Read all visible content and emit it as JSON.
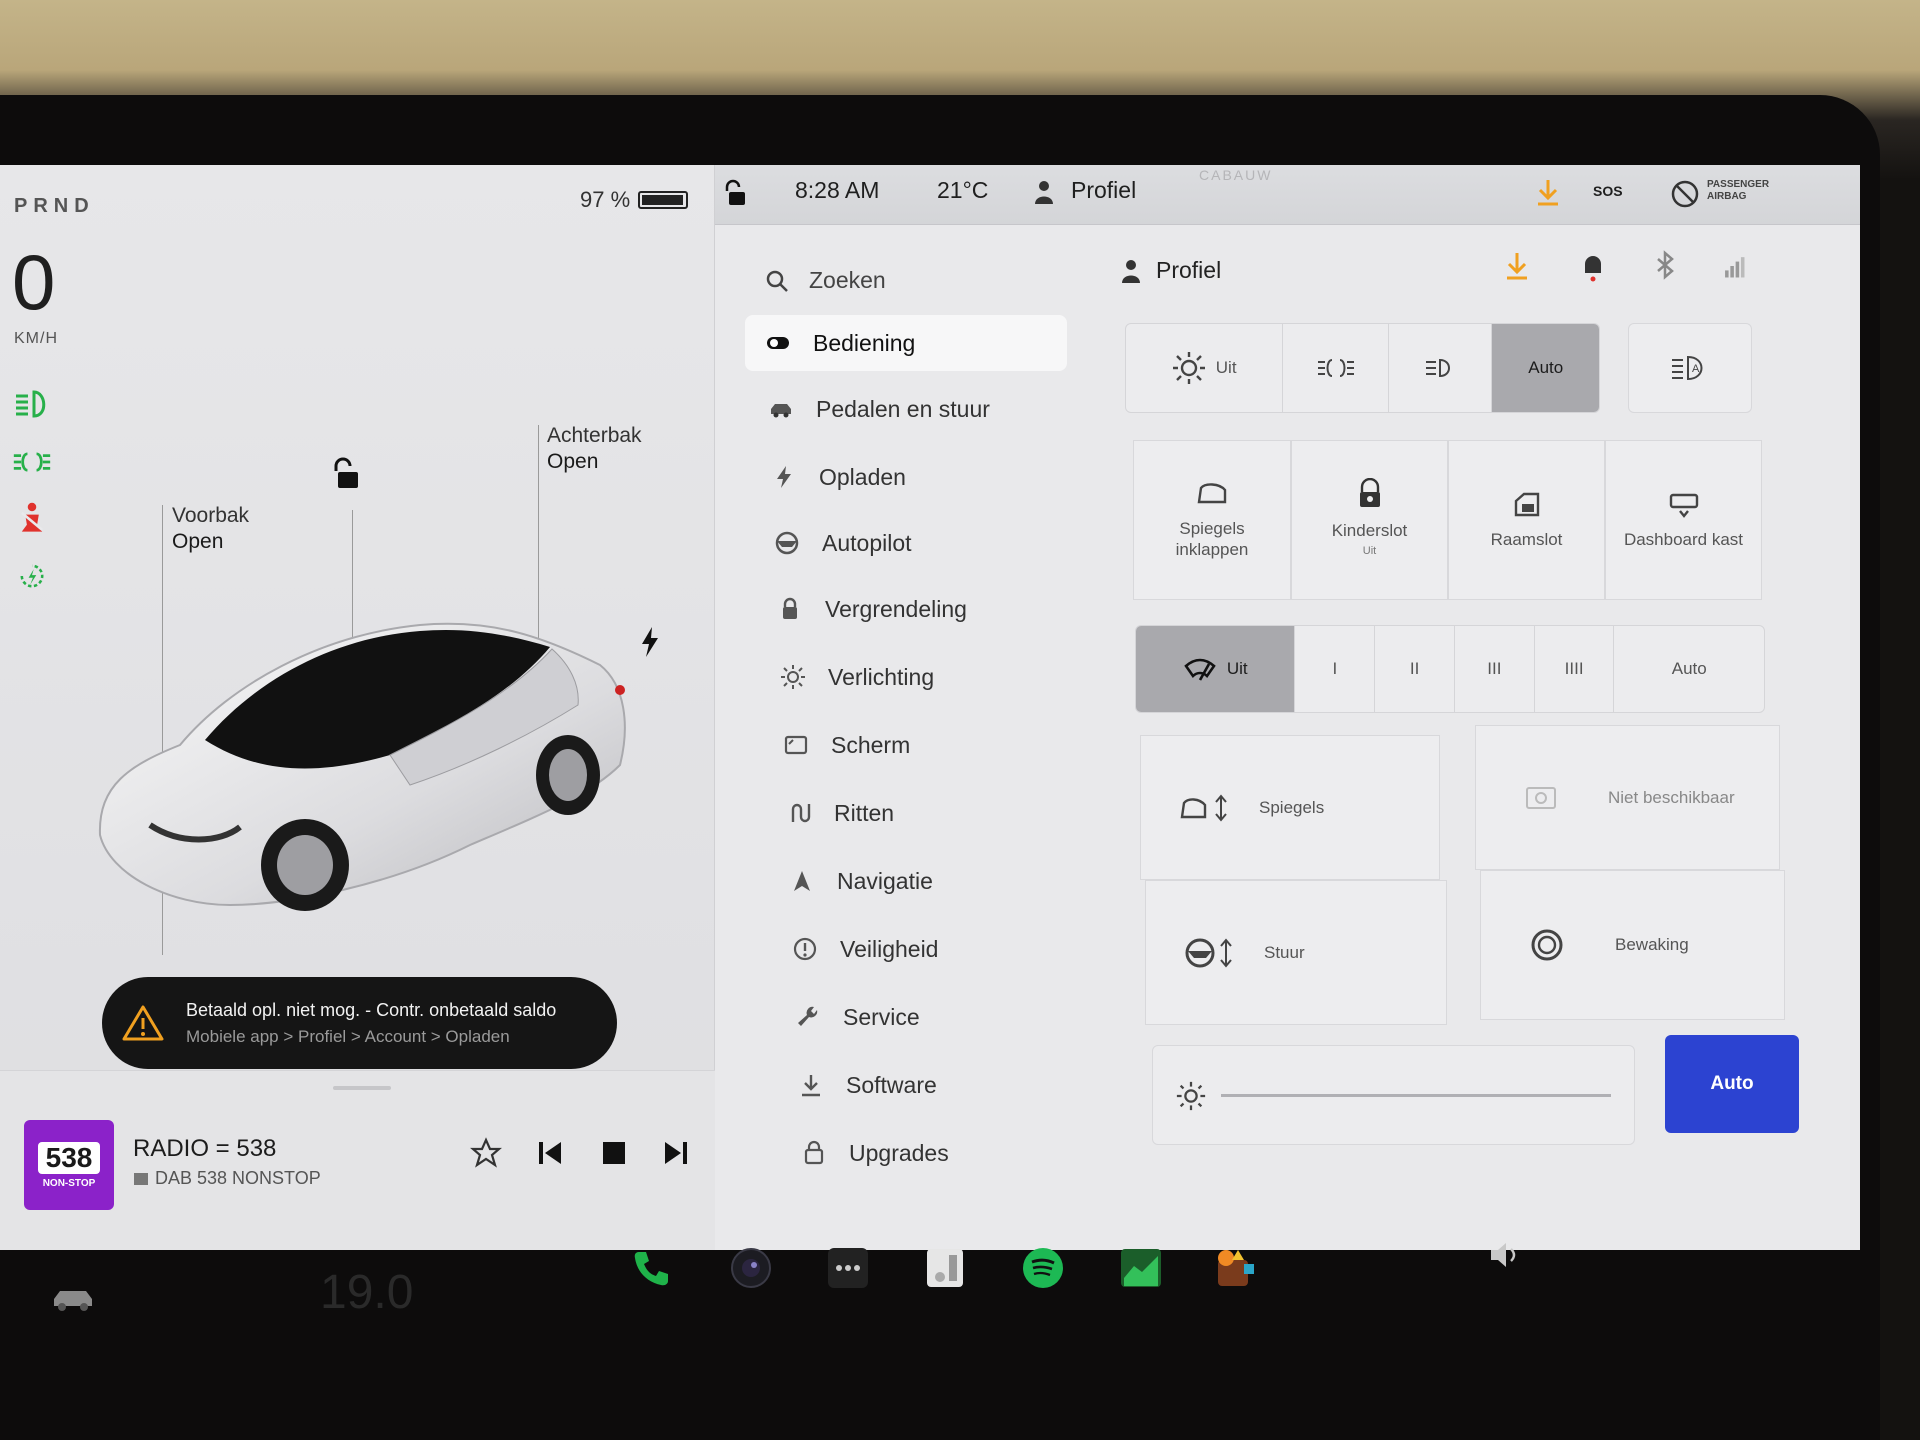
{
  "left_panel": {
    "gear": "PRND",
    "battery_percent": "97 %",
    "battery_level": 0.97,
    "speed": "0",
    "speed_unit": "KM/H",
    "front_trunk_label": "Voorbak",
    "front_trunk_state": "Open",
    "rear_trunk_label": "Achterbak",
    "rear_trunk_state": "Open",
    "alert_title": "Betaald opl. niet mog. - Contr. onbetaald saldo",
    "alert_subtitle": "Mobiele app > Profiel > Account > Opladen",
    "telltales": [
      "headlight-icon",
      "parking-light-icon",
      "seatbelt-warning-icon",
      "regen-icon"
    ]
  },
  "media": {
    "station_logo_number": "538",
    "station_logo_sub": "NON-STOP",
    "title": "RADIO = 538",
    "subtitle": "DAB 538 NONSTOP"
  },
  "status_bar": {
    "time": "8:28 AM",
    "temperature": "21°C",
    "profile": "Profiel",
    "sos": "SOS",
    "airbag_line1": "PASSENGER",
    "airbag_line2": "AIRBAG",
    "map_label": "CABAUW"
  },
  "menu": {
    "search": "Zoeken",
    "items": [
      {
        "label": "Bediening",
        "icon": "toggle-icon",
        "active": true
      },
      {
        "label": "Pedalen en stuur",
        "icon": "car-icon"
      },
      {
        "label": "Opladen",
        "icon": "bolt-icon"
      },
      {
        "label": "Autopilot",
        "icon": "steering-wheel-icon"
      },
      {
        "label": "Vergrendeling",
        "icon": "lock-icon"
      },
      {
        "label": "Verlichting",
        "icon": "sun-icon"
      },
      {
        "label": "Scherm",
        "icon": "display-icon"
      },
      {
        "label": "Ritten",
        "icon": "trips-icon"
      },
      {
        "label": "Navigatie",
        "icon": "navigation-icon"
      },
      {
        "label": "Veiligheid",
        "icon": "safety-icon"
      },
      {
        "label": "Service",
        "icon": "wrench-icon"
      },
      {
        "label": "Software",
        "icon": "download-icon"
      },
      {
        "label": "Upgrades",
        "icon": "bag-icon"
      }
    ]
  },
  "content": {
    "profile": "Profiel",
    "lights": {
      "off": "Uit",
      "auto": "Auto",
      "selected": "Auto"
    },
    "tiles": {
      "fold_mirrors_1": "Spiegels",
      "fold_mirrors_2": "inklappen",
      "child_lock": "Kinderslot",
      "child_lock_state": "Uit",
      "window_lock": "Raamslot",
      "glovebox": "Dashboard kast"
    },
    "wipers": {
      "off": "Uit",
      "speeds": [
        "I",
        "II",
        "III",
        "IIII"
      ],
      "auto": "Auto",
      "selected": "Uit"
    },
    "adjust": {
      "mirrors": "Spiegels",
      "steering": "Stuur",
      "unavailable": "Niet beschikbaar",
      "surveillance": "Bewaking"
    },
    "brightness_auto": "Auto"
  },
  "taskbar": {
    "ghost_temp": "19.0",
    "apps": [
      "car-icon",
      "phone-icon",
      "camera-icon",
      "more-icon",
      "energy-app-icon",
      "spotify-icon",
      "stocks-icon",
      "toybox-icon",
      "volume-icon"
    ]
  },
  "colors": {
    "accent_blue": "#2c43d1",
    "tell_green": "#27b04a",
    "tell_red": "#e0322d",
    "spotify_green": "#1db954",
    "radio_purple": "#8b22c9",
    "download_orange": "#f0a020"
  }
}
